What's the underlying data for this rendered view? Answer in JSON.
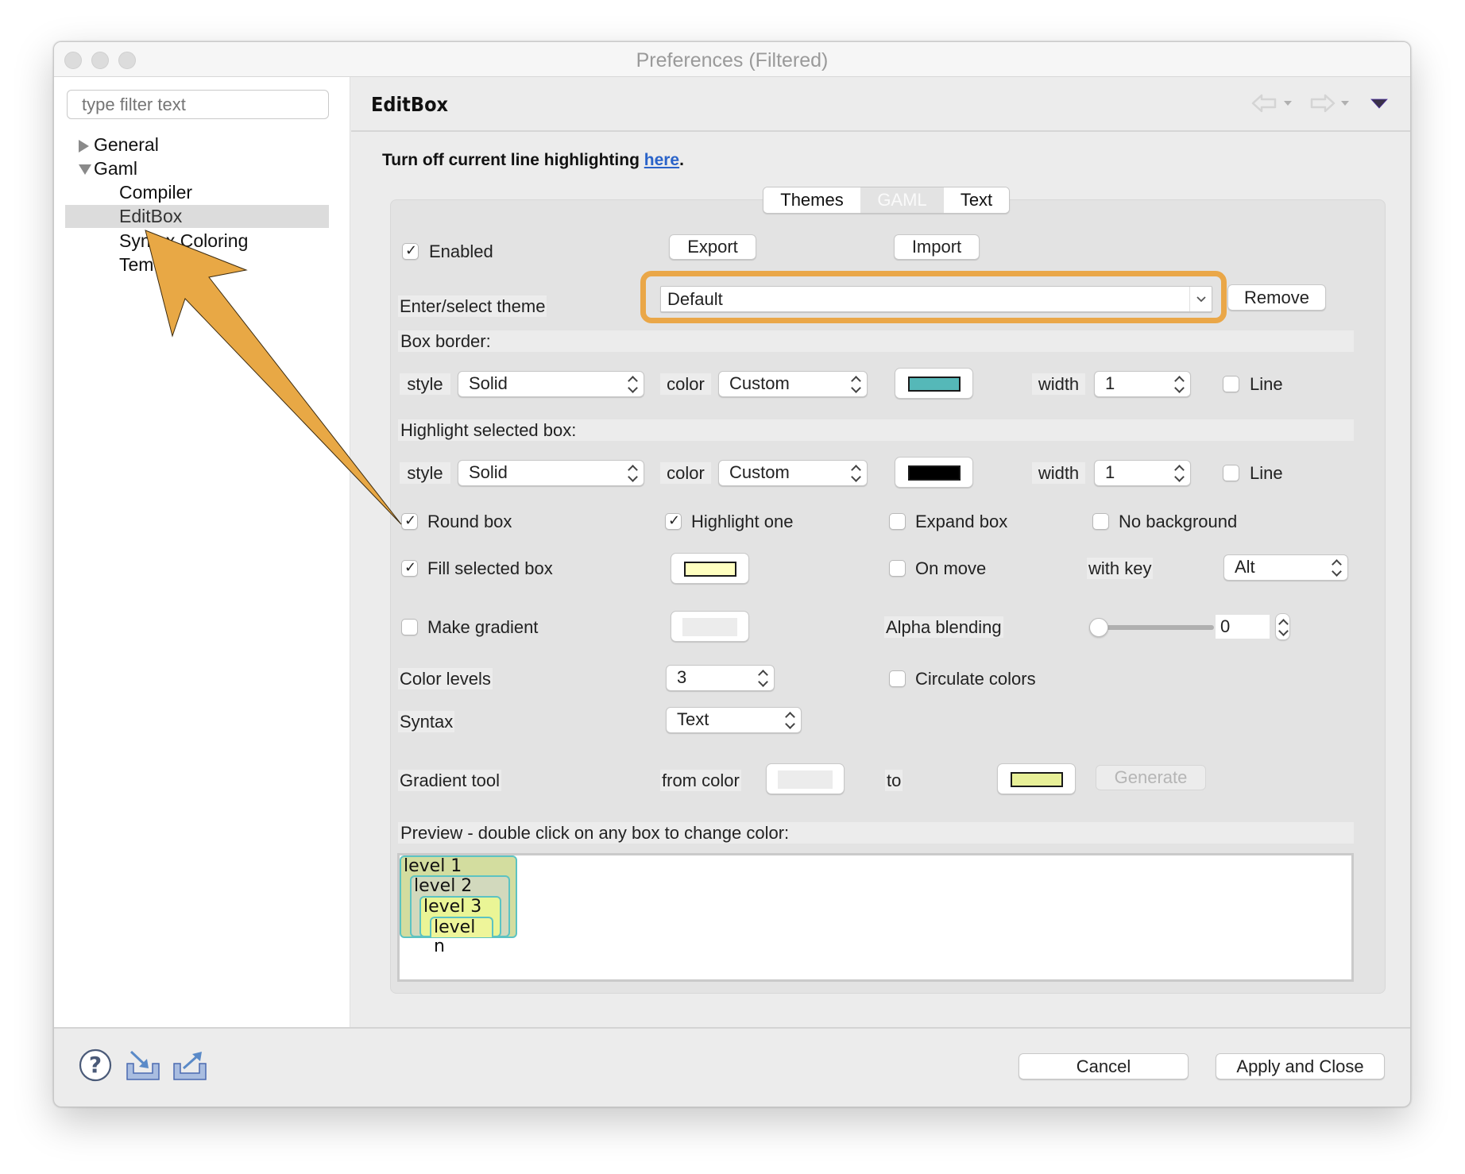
{
  "window": {
    "title": "Preferences (Filtered)"
  },
  "sidebar": {
    "filter_placeholder": "type filter text",
    "tree": [
      {
        "label": "General",
        "expanded": false,
        "level": 0
      },
      {
        "label": "Gaml",
        "expanded": true,
        "level": 0
      },
      {
        "label": "Compiler",
        "level": 1
      },
      {
        "label": "EditBox",
        "level": 1,
        "selected": true
      },
      {
        "label": "Syntax Coloring",
        "level": 1
      },
      {
        "label": "Tem",
        "level": 1
      }
    ]
  },
  "header": {
    "title": "EditBox",
    "nav_icons": [
      "back-arrow-icon",
      "forward-arrow-icon",
      "view-menu-icon"
    ]
  },
  "info": {
    "text": "Turn off current line highlighting ",
    "link": "here",
    "suffix": "."
  },
  "tabs": [
    {
      "label": "Themes",
      "active": false
    },
    {
      "label": "GAML",
      "active": true
    },
    {
      "label": "Text",
      "active": false
    }
  ],
  "form": {
    "enabled": {
      "label": "Enabled",
      "checked": true
    },
    "export_label": "Export",
    "import_label": "Import",
    "theme": {
      "label": "Enter/select theme",
      "value": "Default",
      "remove_label": "Remove"
    },
    "box_border": {
      "section": "Box border:",
      "style_label": "style",
      "style_value": "Solid",
      "color_label": "color",
      "color_value": "Custom",
      "swatch_color": "#55b8b8",
      "width_label": "width",
      "width_value": "1",
      "line_label": "Line",
      "line_checked": false
    },
    "highlight": {
      "section": "Highlight selected box:",
      "style_label": "style",
      "style_value": "Solid",
      "color_label": "color",
      "color_value": "Custom",
      "swatch_color": "#000000",
      "width_label": "width",
      "width_value": "1",
      "line_label": "Line",
      "line_checked": false
    },
    "round_box": {
      "label": "Round box",
      "checked": true
    },
    "highlight_one": {
      "label": "Highlight one",
      "checked": true
    },
    "expand_box": {
      "label": "Expand box",
      "checked": false
    },
    "no_background": {
      "label": "No background",
      "checked": false
    },
    "fill_selected": {
      "label": "Fill selected box",
      "checked": true,
      "swatch_color": "#ffffc0"
    },
    "on_move": {
      "label": "On move",
      "checked": false
    },
    "with_key": {
      "label": "with key",
      "value": "Alt"
    },
    "make_gradient": {
      "label": "Make gradient",
      "checked": false
    },
    "alpha": {
      "label": "Alpha blending",
      "value": "0",
      "slider_fraction": 0
    },
    "color_levels": {
      "label": "Color levels",
      "value": "3"
    },
    "circulate": {
      "label": "Circulate colors",
      "checked": false
    },
    "syntax": {
      "label": "Syntax",
      "value": "Text"
    },
    "gradient_tool": {
      "label": "Gradient tool",
      "from_label": "from color",
      "to_label": "to",
      "to_color": "#e8f098",
      "generate_label": "Generate"
    },
    "preview": {
      "label": "Preview - double click on any box to change color:",
      "levels": [
        {
          "label": "level 1",
          "color": "#d3dd9f"
        },
        {
          "label": "level 2",
          "color": "#d2d9bd"
        },
        {
          "label": "level 3",
          "color": "#eaf596"
        },
        {
          "label": "level n",
          "color": "#eef59a"
        }
      ],
      "border_color": "#5cc3c2"
    }
  },
  "footer": {
    "icons": [
      "help-icon",
      "import-icon",
      "export-icon"
    ],
    "cancel_label": "Cancel",
    "apply_label": "Apply and Close"
  },
  "annotation": {
    "highlight_color": "#eaa748",
    "arrow_color": "#e8a845"
  }
}
